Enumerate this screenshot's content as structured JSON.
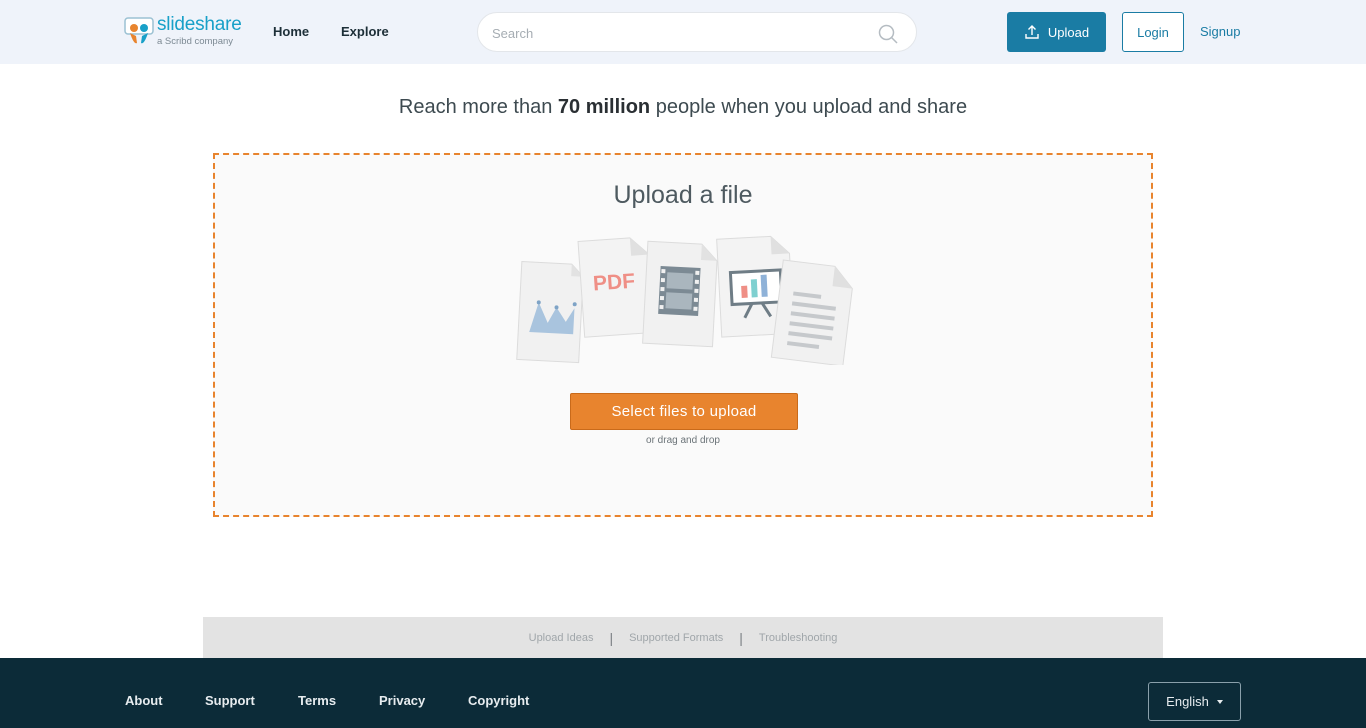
{
  "header": {
    "logo_word": "slideshare",
    "logo_sub": "a Scribd company",
    "nav": [
      {
        "label": "Home"
      },
      {
        "label": "Explore"
      }
    ],
    "search": {
      "placeholder": "Search",
      "value": ""
    },
    "upload_label": "Upload",
    "login_label": "Login",
    "signup_label": "Signup"
  },
  "main": {
    "tagline_prefix": "Reach more than ",
    "tagline_bold": "70 million",
    "tagline_suffix": " people when you upload and share",
    "dropzone": {
      "title": "Upload a file",
      "pdf_label": "PDF",
      "select_button": "Select files to upload",
      "hint": "or drag and drop"
    }
  },
  "help_links": [
    {
      "label": "Upload Ideas"
    },
    {
      "label": "Supported Formats"
    },
    {
      "label": "Troubleshooting"
    }
  ],
  "footer": {
    "links": [
      {
        "label": "About"
      },
      {
        "label": "Support"
      },
      {
        "label": "Terms"
      },
      {
        "label": "Privacy"
      },
      {
        "label": "Copyright"
      }
    ],
    "language": "English"
  },
  "colors": {
    "header_bg": "#eff3fa",
    "brand_blue": "#1a7ca4",
    "accent_orange": "#e8842e",
    "footer_bg": "#0c2b38"
  }
}
